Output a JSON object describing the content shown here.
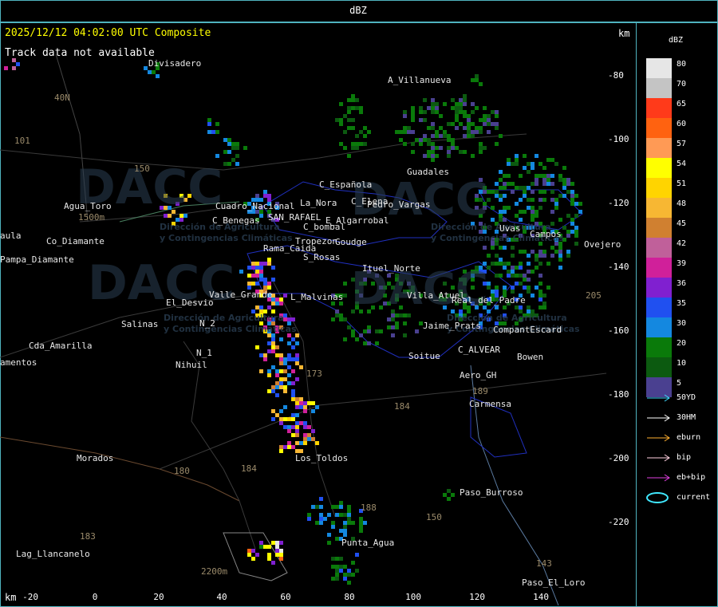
{
  "header": {
    "title": "dBZ"
  },
  "map": {
    "title": "2025/12/12 04:02:00 UTC Composite",
    "track_note": "Track data not available",
    "km_top": "km",
    "km_bottom": "km",
    "x_ticks": [
      "-20",
      "0",
      "20",
      "40",
      "60",
      "80",
      "100",
      "120",
      "140"
    ],
    "y_ticks": [
      "-80",
      "-100",
      "-120",
      "-140",
      "-160",
      "-180",
      "-200",
      "-220"
    ],
    "places": [
      "Divisadero",
      "A_Villanueva",
      "40N",
      "101",
      "150",
      "Agua_Toro",
      "1500m",
      "aula",
      "Co_Diamante",
      "Pampa_Diamante",
      "C_Benegas",
      "SAN_RAFAEL",
      "E_Algarrobal",
      "C_Española",
      "La_Nora",
      "C_Elena",
      "Cuadro_Nacional",
      "Pedro_Vargas",
      "Rama_Caida",
      "C_bombal",
      "Tropezon",
      "Goudge",
      "S_Rosas",
      "Ituel_Norte",
      "Jaime_Prats",
      "Guadales",
      "Villa_Atuel",
      "Real_del_Padre",
      "Campos",
      "Uvas",
      "El_Desvio",
      "Valle_Grande",
      "L_Malvinas",
      "Salinas",
      "Cda_Amarilla",
      "amentos",
      "Nihuil",
      "N_1",
      "N_2",
      "Soitue",
      "C_ALVEAR",
      "Bowen",
      "CompantEscard",
      "Aero_GH",
      "Carmensa",
      "Los_Toldos",
      "Morados",
      "180",
      "184",
      "183",
      "Paso_Burroso",
      "Punta_Agua",
      "Lag_Llancanelo",
      "2200m",
      "Paso_El_Loro",
      "143",
      "150",
      "184",
      "205",
      "173",
      "189",
      "188",
      "Ovejero"
    ]
  },
  "watermark": {
    "brand": "DACC",
    "line1": "Dirección de Agricultura",
    "line2": "y Contingencias Climáticas"
  },
  "legend": {
    "title": "dBZ",
    "scale": [
      {
        "value": "80",
        "color": "#e6e6e6"
      },
      {
        "value": "70",
        "color": "#c4c4c4"
      },
      {
        "value": "65",
        "color": "#ff3a1a"
      },
      {
        "value": "60",
        "color": "#ff6210"
      },
      {
        "value": "57",
        "color": "#ff9a55"
      },
      {
        "value": "54",
        "color": "#ffff00"
      },
      {
        "value": "51",
        "color": "#ffd400"
      },
      {
        "value": "48",
        "color": "#f7b733"
      },
      {
        "value": "45",
        "color": "#d08030"
      },
      {
        "value": "42",
        "color": "#c0609a"
      },
      {
        "value": "39",
        "color": "#d0209a"
      },
      {
        "value": "36",
        "color": "#8020d0"
      },
      {
        "value": "35",
        "color": "#2050f0"
      },
      {
        "value": "30",
        "color": "#1488e0"
      },
      {
        "value": "20",
        "color": "#0a7a0a"
      },
      {
        "value": "10",
        "color": "#0c5a10"
      },
      {
        "value": "5",
        "color": "#4a4090"
      }
    ],
    "tracks": [
      {
        "label": "50YD",
        "color": "#40d8ff"
      },
      {
        "label": "30HM",
        "color": "#ffffff"
      },
      {
        "label": "eburn",
        "color": "#ffb030"
      },
      {
        "label": "bip",
        "color": "#ffd0e0"
      },
      {
        "label": "eb+bip",
        "color": "#e040e0"
      },
      {
        "label": "current",
        "color": "#40e8ff"
      }
    ]
  }
}
